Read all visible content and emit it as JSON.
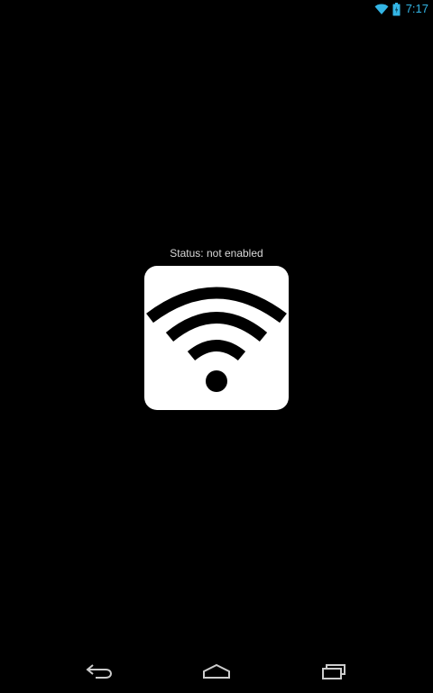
{
  "status_bar": {
    "time": "7:17",
    "icons": [
      "wifi-icon",
      "battery-icon"
    ],
    "accent_color": "#33b5e5"
  },
  "main": {
    "status_label": "Status: not enabled",
    "toggle_icon": "wifi-icon",
    "toggle_background": "#ffffff",
    "toggle_foreground": "#000000"
  },
  "nav_bar": {
    "buttons": [
      "back-icon",
      "home-icon",
      "recents-icon"
    ],
    "color": "#cccccc"
  }
}
